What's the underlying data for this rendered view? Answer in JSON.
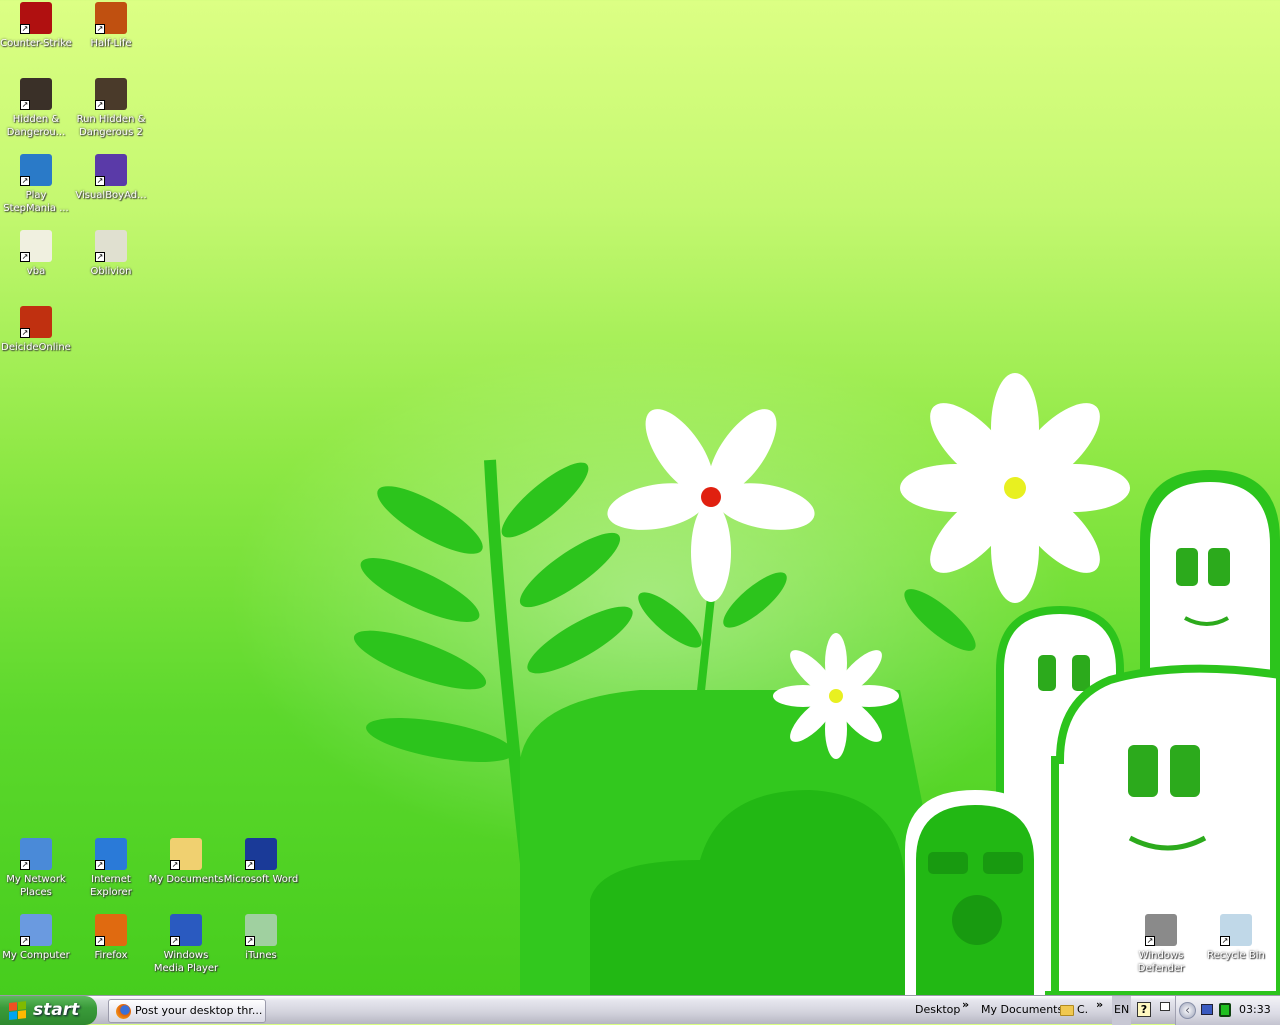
{
  "desktop": {
    "icons_left": [
      {
        "label": "Counter-Strike",
        "icon": "counter-strike-icon",
        "color": "#b01010"
      },
      {
        "label": "Half-Life",
        "icon": "half-life-icon",
        "color": "#c05010"
      },
      {
        "label": "Hidden & Dangerou...",
        "icon": "hidden-dangerous-icon",
        "color": "#3a3028"
      },
      {
        "label": "Run Hidden & Dangerous 2",
        "icon": "hidden-dangerous-2-icon",
        "color": "#4a3a2a"
      },
      {
        "label": "Play StepMania ...",
        "icon": "stepmania-icon",
        "color": "#2a7ac8"
      },
      {
        "label": "VisualBoyAd...",
        "icon": "visualboyadvance-icon",
        "color": "#5a3aa8"
      },
      {
        "label": "vba",
        "icon": "config-file-icon",
        "color": "#f0f0e0"
      },
      {
        "label": "Oblivion",
        "icon": "oblivion-icon",
        "color": "#e0e0d0"
      },
      {
        "label": "DeicideOnline",
        "icon": "deicide-online-icon",
        "color": "#c03010"
      }
    ],
    "icons_bottom": [
      {
        "label": "My Network Places",
        "icon": "network-places-icon",
        "color": "#4a8ad8"
      },
      {
        "label": "Internet Explorer",
        "icon": "internet-explorer-icon",
        "color": "#2a7ad8"
      },
      {
        "label": "My Documents",
        "icon": "my-documents-icon",
        "color": "#f0d070"
      },
      {
        "label": "Microsoft Word",
        "icon": "word-icon",
        "color": "#1a3a98"
      },
      {
        "label": "My Computer",
        "icon": "my-computer-icon",
        "color": "#6a9ae0"
      },
      {
        "label": "Firefox",
        "icon": "firefox-icon",
        "color": "#e06a10"
      },
      {
        "label": "Windows Media Player",
        "icon": "media-player-icon",
        "color": "#2a5ac0"
      },
      {
        "label": "iTunes",
        "icon": "itunes-icon",
        "color": "#a0d0a0"
      }
    ],
    "icons_right": [
      {
        "label": "Windows Defender",
        "icon": "windows-defender-icon",
        "color": "#8a8a8a"
      },
      {
        "label": "Recycle Bin",
        "icon": "recycle-bin-icon",
        "color": "#c0d8e8"
      }
    ]
  },
  "taskbar": {
    "start_label": "start",
    "task_label": "Post your desktop thr...",
    "toolbars": [
      "Desktop",
      "My Documents",
      "C."
    ],
    "chevron": "»",
    "language": "EN",
    "help": "?",
    "clock": "03:33"
  }
}
